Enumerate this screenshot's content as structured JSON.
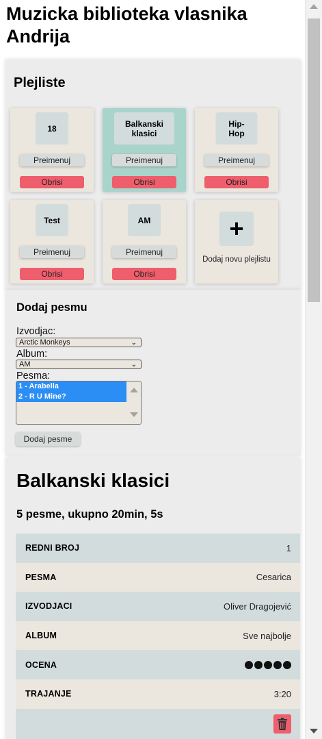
{
  "app": {
    "title": "Muzicka biblioteka vlasnika Andrija"
  },
  "playlists": {
    "heading": "Plejliste",
    "rename_label": "Preimenuj",
    "delete_label": "Obrisi",
    "add_new_label": "Dodaj novu plejlistu",
    "add_new_icon": "plus-icon",
    "selected": "Balkanski klasici",
    "items": [
      {
        "name": "18"
      },
      {
        "name": "Balkanski klasici"
      },
      {
        "name": "Hip-Hop"
      },
      {
        "name": "Test"
      },
      {
        "name": "AM"
      }
    ]
  },
  "add_song": {
    "heading": "Dodaj pesmu",
    "artist_label": "Izvodjac:",
    "artist_value": "Arctic Monkeys",
    "album_label": "Album:",
    "album_value": "AM",
    "song_label": "Pesma:",
    "songs": [
      {
        "label": "1 - Arabella"
      },
      {
        "label": "2 - R U Mine?"
      }
    ],
    "submit_label": "Dodaj pesme"
  },
  "detail": {
    "title": "Balkanski klasici",
    "summary": "5 pesme, ukupno 20min, 5s",
    "rows": {
      "number": {
        "key": "REDNI BROJ",
        "value": "1"
      },
      "song": {
        "key": "PESMA",
        "value": "Cesarica"
      },
      "artists": {
        "key": "IZVODJACI",
        "value": "Oliver Dragojević"
      },
      "album": {
        "key": "ALBUM",
        "value": "Sve najbolje"
      },
      "rating": {
        "key": "OCENA",
        "value": 5
      },
      "duration": {
        "key": "TRAJANJE",
        "value": "3:20"
      }
    },
    "delete_icon": "trash-icon"
  },
  "colors": {
    "card_bg": "#ebe6de",
    "card_selected_bg": "#a9d4cc",
    "delete_red": "#ee5e6d",
    "selection_blue": "#2b8ef5",
    "row_alt_bg": "#d2dcdc"
  }
}
